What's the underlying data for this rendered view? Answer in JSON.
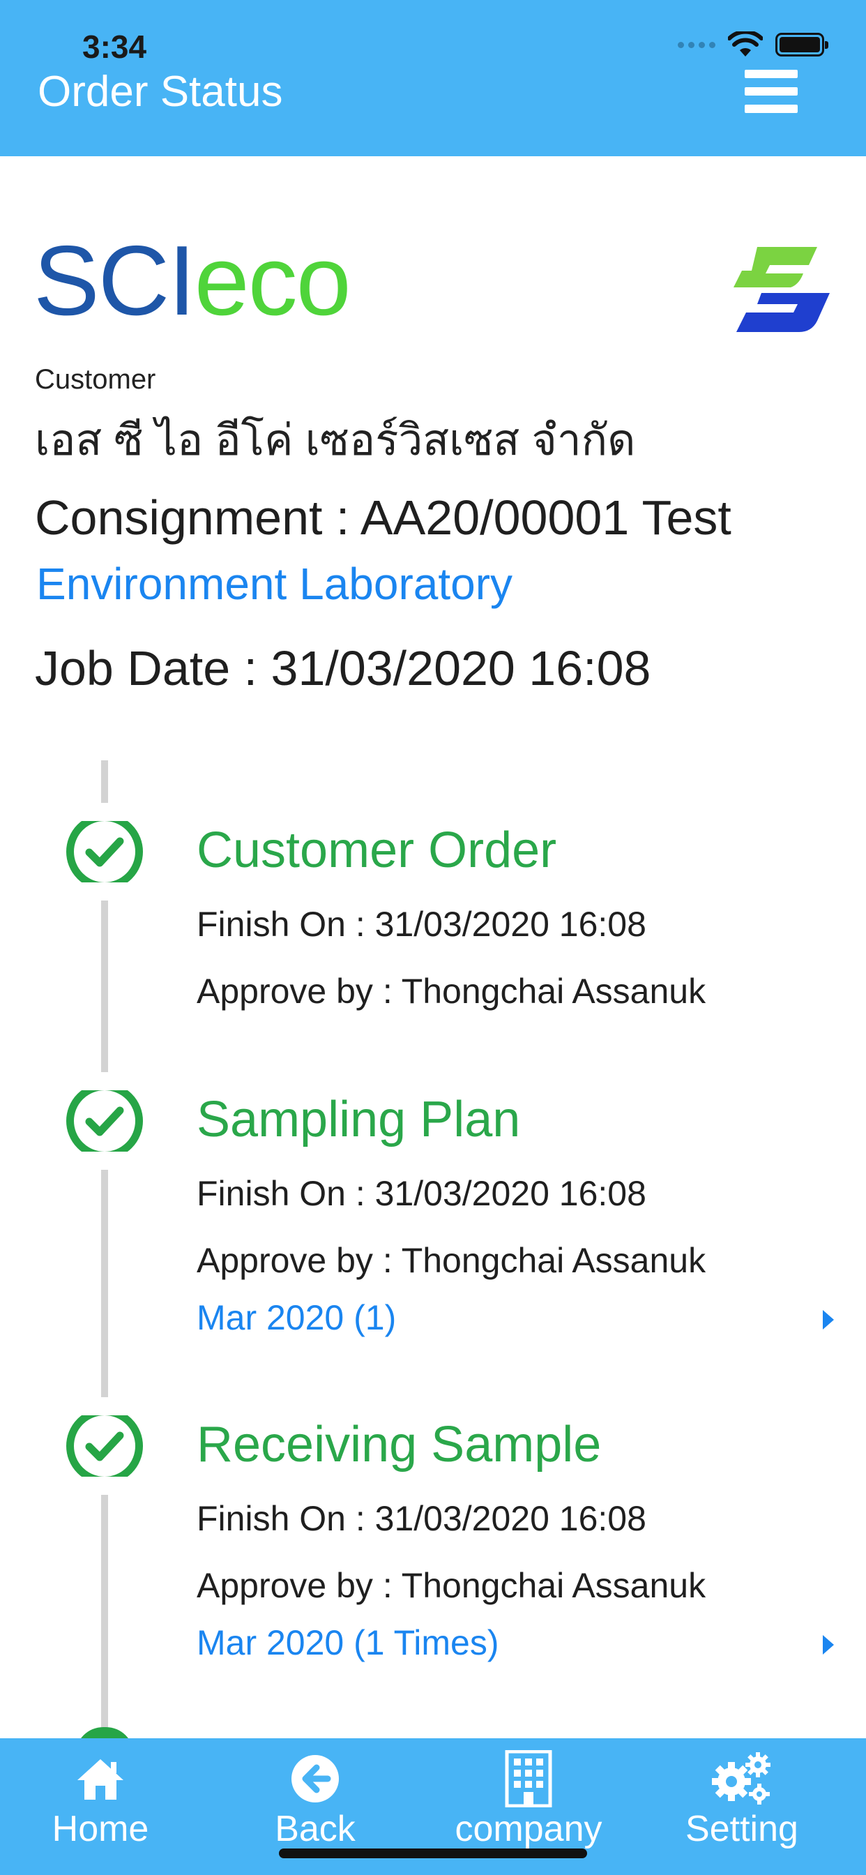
{
  "status_bar": {
    "time": "3:34"
  },
  "header": {
    "title": "Order Status"
  },
  "brand": {
    "logo_left": "SCI",
    "logo_right": "eco"
  },
  "info": {
    "customer_label": "Customer",
    "customer_name": "เอส ซี ไอ อีโค่ เซอร์วิสเซส จำกัด",
    "consignment": "Consignment : AA20/00001 Test",
    "lab": "Environment Laboratory",
    "job_date": "Job Date : 31/03/2020 16:08"
  },
  "steps": [
    {
      "title": "Customer Order",
      "finish": "Finish On : 31/03/2020 16:08",
      "approve": "Approve by : Thongchai Assanuk"
    },
    {
      "title": "Sampling Plan",
      "finish": "Finish On : 31/03/2020 16:08",
      "approve": "Approve by : Thongchai Assanuk",
      "link": "Mar 2020 (1)"
    },
    {
      "title": "Receiving Sample",
      "finish": "Finish On : 31/03/2020 16:08",
      "approve": "Approve by : Thongchai Assanuk",
      "link": "Mar 2020 (1 Times)"
    }
  ],
  "tabs": [
    {
      "label": "Home",
      "icon": "home-icon"
    },
    {
      "label": "Back",
      "icon": "back-arrow-icon"
    },
    {
      "label": "company",
      "icon": "building-icon"
    },
    {
      "label": "Setting",
      "icon": "gears-icon"
    }
  ],
  "colors": {
    "header_bg": "#48b4f5",
    "step_green": "#2aa74a",
    "link_blue": "#1a85f0",
    "logo_blue": "#1e56a8",
    "logo_green": "#4fd43a"
  }
}
